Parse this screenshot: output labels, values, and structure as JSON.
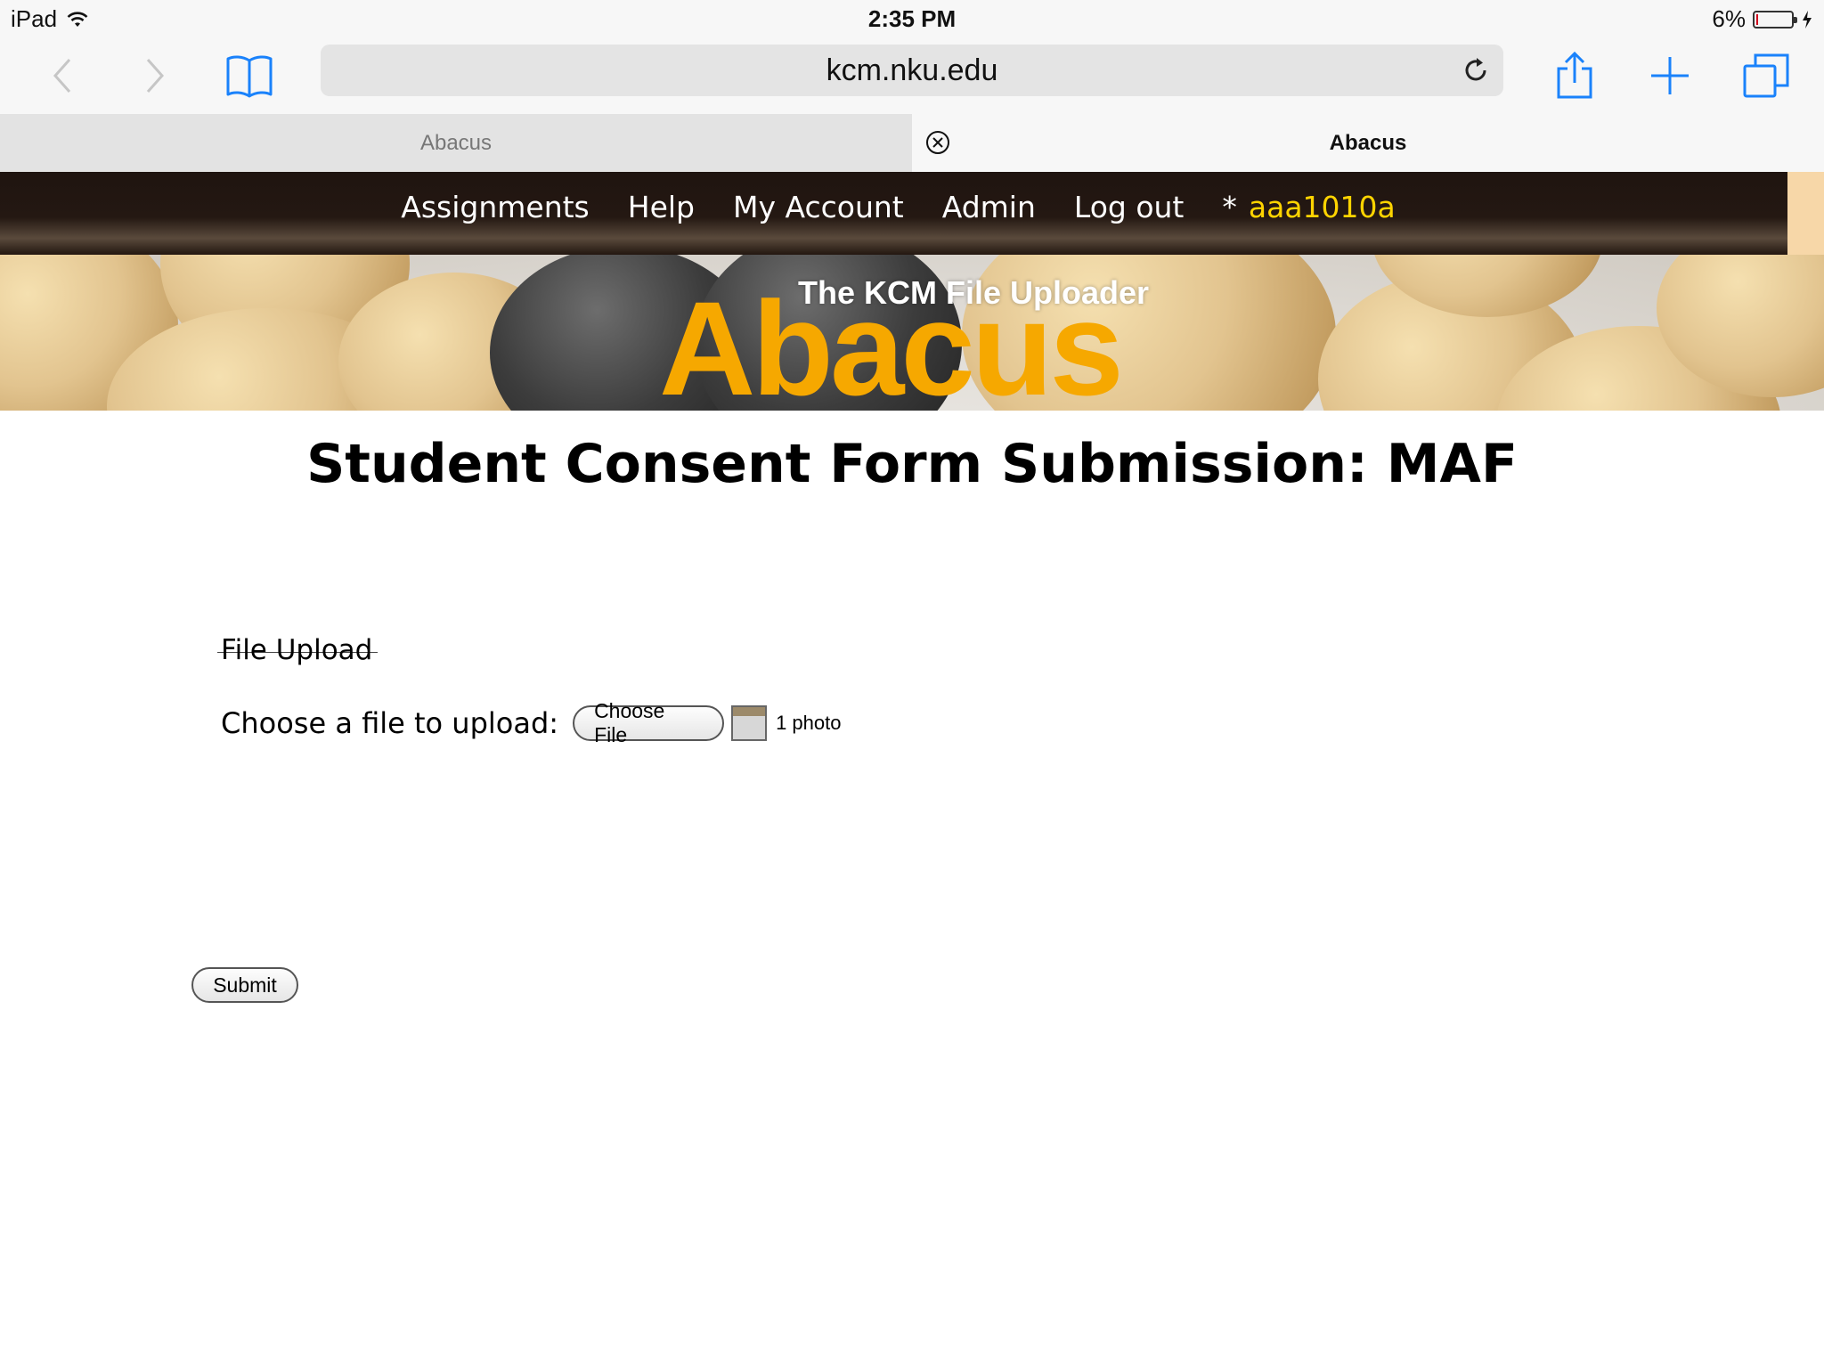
{
  "status_bar": {
    "device": "iPad",
    "time": "2:35 PM",
    "battery_percent": "6%",
    "battery_level": 0.06
  },
  "browser": {
    "url": "kcm.nku.edu",
    "icons": {
      "back": "chevron-left-icon",
      "forward": "chevron-right-icon",
      "bookmarks": "book-icon",
      "reload": "reload-icon",
      "share": "share-icon",
      "new_tab": "plus-icon",
      "tabs": "tabs-icon"
    },
    "tabs": [
      {
        "label": "Abacus",
        "active": false
      },
      {
        "label": "Abacus",
        "active": true
      }
    ]
  },
  "site_nav": {
    "items": [
      "Assignments",
      "Help",
      "My Account",
      "Admin",
      "Log out"
    ],
    "user_marker": "*",
    "username": "aaa1010a"
  },
  "banner": {
    "subtitle": "The KCM File Uploader",
    "title": "Abacus",
    "title_color": "#f6a800"
  },
  "page": {
    "title": "Student Consent Form Submission: MAF",
    "section_title": "File Upload",
    "upload_label": "Choose a file to upload:",
    "choose_button": "Choose File",
    "file_status": "1 photo",
    "submit_button": "Submit"
  },
  "colors": {
    "nav_background": "#241812",
    "username": "#ffd400",
    "ios_blue": "#1a82fb"
  }
}
